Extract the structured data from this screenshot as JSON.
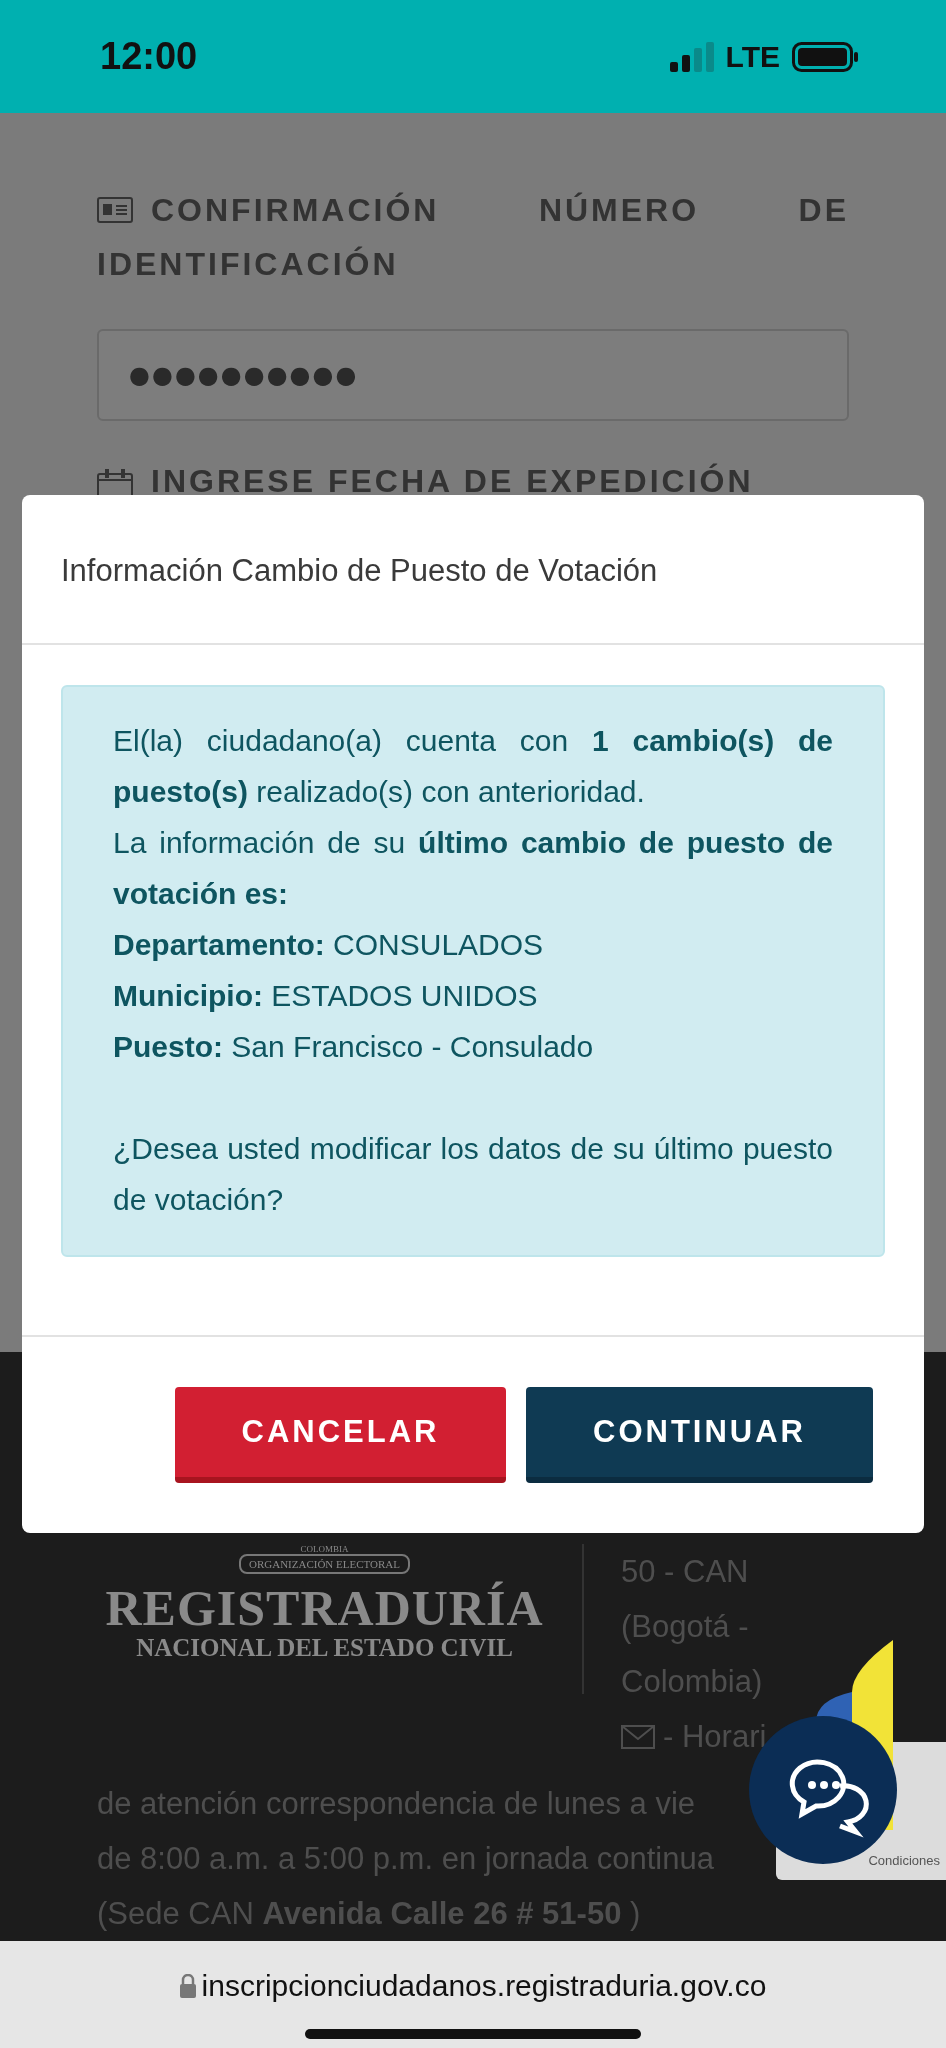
{
  "status_bar": {
    "time": "12:00",
    "network": "LTE"
  },
  "form": {
    "id_section": {
      "label_lines": [
        "CONFIRMACIÓN NÚMERO DE",
        "IDENTIFICACIÓN"
      ],
      "value": "●●●●●●●●●●"
    },
    "date_section": {
      "label": "INGRESE FECHA DE EXPEDICIÓN"
    }
  },
  "modal": {
    "title": "Información Cambio de Puesto de Votación",
    "paragraphs": [
      "El(la) ciudadano(a) cuenta con **1 cambio(s) de puesto(s)** realizado(s) con anterioridad.",
      "La información de su **último cambio de puesto de votación es:**"
    ],
    "details": [
      {
        "label": "Departamento:",
        "value": "CONSULADOS"
      },
      {
        "label": "Municipio:",
        "value": "ESTADOS UNIDOS"
      },
      {
        "label": "Puesto:",
        "value": "San Francisco - Consulado"
      }
    ],
    "question": "¿Desea usted modificar los datos de su último puesto de votación?",
    "buttons": [
      {
        "label": "CANCELAR",
        "kind": "cancel"
      },
      {
        "label": "CONTINUAR",
        "kind": "continue"
      }
    ]
  },
  "footer": {
    "logo": {
      "seal_top": "COLOMBIA",
      "seal_band": "ORGANIZACIÓN ELECTORAL",
      "name": "REGISTRADURÍA",
      "subtitle": "NACIONAL DEL ESTADO CIVIL"
    },
    "address_lines": [
      "50 - CAN",
      "(Bogotá -",
      "Colombia)"
    ],
    "contact": "- Horari",
    "lines": [
      "de atención correspondencia de lunes a vie",
      "de 8:00 a.m. a 5:00 p.m. en jornada continua",
      "(Sede CAN **Avenida Calle 26 # 51-50** )"
    ]
  },
  "recaptcha": {
    "label": "Condiciones"
  },
  "browser": {
    "url": "inscripcionciudadanos.registraduria.gov.co"
  }
}
